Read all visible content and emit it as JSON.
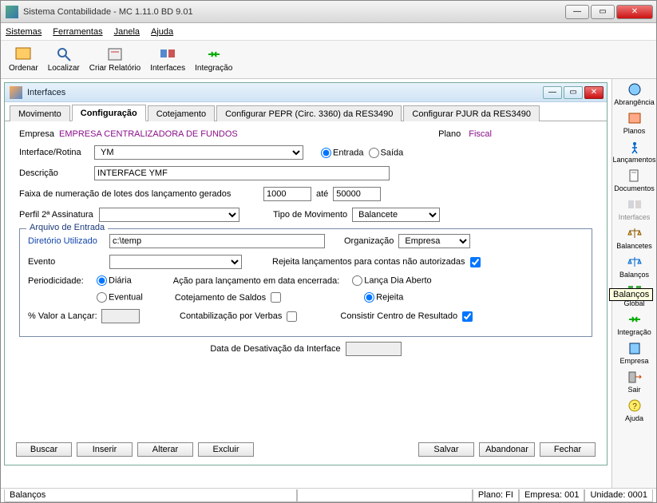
{
  "window_title": "Sistema Contabilidade -  MC 1.11.0 BD 9.01",
  "menubar": [
    "Sistemas",
    "Ferramentas",
    "Janela",
    "Ajuda"
  ],
  "toolbar": [
    {
      "label": "Ordenar"
    },
    {
      "label": "Localizar"
    },
    {
      "label": "Criar Relatório"
    },
    {
      "label": "Interfaces"
    },
    {
      "label": "Integração"
    }
  ],
  "sidebar": {
    "items": [
      {
        "label": "Abrangência"
      },
      {
        "label": "Planos"
      },
      {
        "label": "Lançamentos"
      },
      {
        "label": "Documentos"
      },
      {
        "label": "Interfaces"
      },
      {
        "label": "Balancetes"
      },
      {
        "label": "Balanços"
      },
      {
        "label": "Global"
      },
      {
        "label": "Integração"
      },
      {
        "label": "Empresa"
      },
      {
        "label": "Sair"
      },
      {
        "label": "Ajuda"
      }
    ],
    "tooltip": "Balanços"
  },
  "inner": {
    "title": "Interfaces",
    "tabs": [
      {
        "label": "Movimento"
      },
      {
        "label": "Configuração",
        "active": true
      },
      {
        "label": "Cotejamento"
      },
      {
        "label": "Configurar PEPR (Circ. 3360) da RES3490"
      },
      {
        "label": "Configurar PJUR da RES3490"
      }
    ],
    "empresa_label": "Empresa",
    "empresa_value": "EMPRESA CENTRALIZADORA DE FUNDOS",
    "plano_label": "Plano",
    "plano_value": "Fiscal",
    "interface_rotina_label": "Interface/Rotina",
    "interface_rotina_value": "YM",
    "entrada_label": "Entrada",
    "saida_label": "Saída",
    "descricao_label": "Descrição",
    "descricao_value": "INTERFACE YMF",
    "faixa_label": "Faixa de numeração de lotes dos lançamento gerados",
    "faixa_from": "1000",
    "faixa_ate_label": "até",
    "faixa_to": "50000",
    "perfil_label": "Perfil 2ª Assinatura",
    "tipo_mov_label": "Tipo de Movimento",
    "tipo_mov_value": "Balancete",
    "group_title": "Arquivo de Entrada",
    "diretorio_label": "Diretório Utilizado",
    "diretorio_value": "c:\\temp",
    "organizacao_label": "Organização",
    "organizacao_value": "Empresa",
    "evento_label": "Evento",
    "rejeita_label": "Rejeita lançamentos para contas não autorizadas",
    "periodicidade_label": "Periodicidade:",
    "diaria_label": "Diária",
    "eventual_label": "Eventual",
    "acao_label": "Ação para lançamento em data encerrada:",
    "lanca_dia_label": "Lança Dia Aberto",
    "rejeita_radio_label": "Rejeita",
    "cotej_saldos_label": "Cotejamento de Saldos",
    "pct_valor_label": "% Valor a Lançar:",
    "contab_verbas_label": "Contabilização por Verbas",
    "consistir_label": "Consistir Centro de Resultado",
    "data_desativ_label": "Data de Desativação da Interface",
    "buttons": {
      "buscar": "Buscar",
      "inserir": "Inserir",
      "alterar": "Alterar",
      "excluir": "Excluir",
      "salvar": "Salvar",
      "abandonar": "Abandonar",
      "fechar": "Fechar"
    }
  },
  "statusbar": {
    "left": "Balanços",
    "plano": "Plano:    FI",
    "empresa": "Empresa: 001",
    "unidade": "Unidade:  0001"
  }
}
